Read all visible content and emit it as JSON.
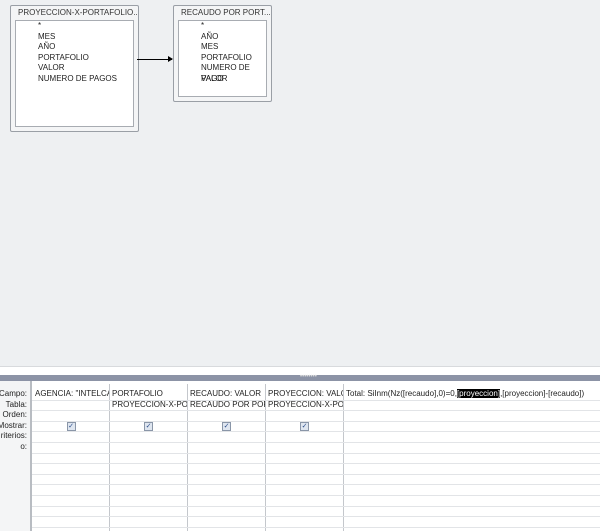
{
  "tables": [
    {
      "title": "PROYECCION-X-PORTAFOLIO...",
      "fields": [
        "*",
        "MES",
        "AÑO",
        "PORTAFOLIO",
        "VALOR",
        "NUMERO DE PAGOS"
      ]
    },
    {
      "title": "RECAUDO POR PORT...",
      "fields": [
        "*",
        "AÑO",
        "MES",
        "PORTAFOLIO",
        "NUMERO DE PAGO",
        "VALOR"
      ]
    }
  ],
  "row_labels": [
    "Campo:",
    "Tabla:",
    "Orden:",
    "Mostrar:",
    "riterios:",
    "o:"
  ],
  "columns": [
    {
      "campo": "AGENCIA: \"INTELCALL",
      "tabla": "",
      "mostrar": true
    },
    {
      "campo": "PORTAFOLIO",
      "tabla": "PROYECCION-X-PORTA",
      "mostrar": true
    },
    {
      "campo": "RECAUDO: VALOR",
      "tabla": "RECAUDO POR PORTA",
      "mostrar": true
    },
    {
      "campo": "PROYECCION: VALOR",
      "tabla": "PROYECCION-X-PORTA",
      "mostrar": true
    }
  ],
  "expr": {
    "pre": "Total: SiInm(Nz([recaudo],0)=0,",
    "sel": "[proyeccion]",
    "post": ",[proyeccion]-[recaudo])"
  },
  "checkmark": "✓"
}
